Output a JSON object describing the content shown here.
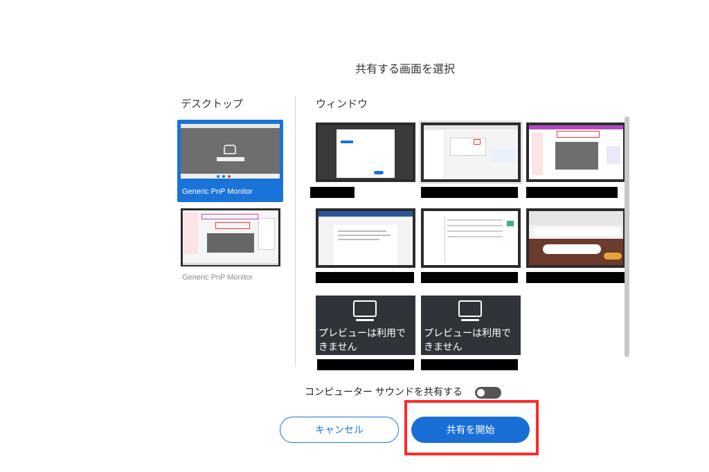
{
  "dialog": {
    "title": "共有する画面を選択"
  },
  "desktop_section": {
    "label": "デスクトップ",
    "monitors": [
      {
        "caption": "Generic PnP Monitor",
        "selected": true
      },
      {
        "caption": "Generic PnP Monitor",
        "selected": false
      }
    ]
  },
  "window_section": {
    "label": "ウィンドウ",
    "no_preview_text": "プレビューは利用できません"
  },
  "sound": {
    "label": "コンピューター サウンドを共有する",
    "enabled": false
  },
  "buttons": {
    "cancel": "キャンセル",
    "start": "共有を開始"
  },
  "colors": {
    "accent": "#1a73d9",
    "highlight": "#ff2a2a"
  }
}
